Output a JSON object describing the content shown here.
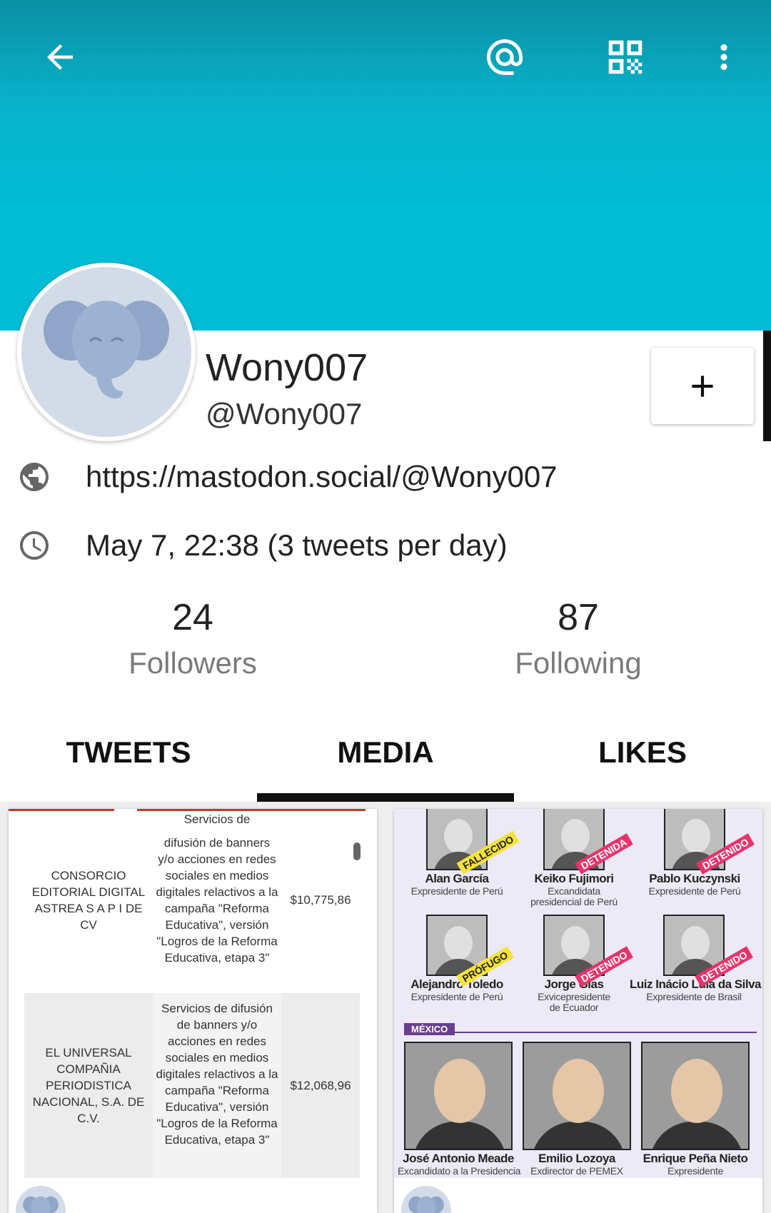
{
  "profile": {
    "display_name": "Wony007",
    "handle": "@Wony007",
    "url": "https://mastodon.social/@Wony007",
    "joined_text": "May 7, 22:38 (3 tweets per day)"
  },
  "stats": {
    "followers_count": "24",
    "followers_label": "Followers",
    "following_count": "87",
    "following_label": "Following"
  },
  "tabs": [
    {
      "label": "TWEETS",
      "active": false
    },
    {
      "label": "MEDIA",
      "active": true
    },
    {
      "label": "LIKES",
      "active": false
    }
  ],
  "colors": {
    "banner": "#00bcd4",
    "avatar_bg": "#d2dbe8",
    "avatar_icon": "#8fa6c8"
  },
  "icons": [
    "back-arrow-icon",
    "at-icon",
    "qr-code-icon",
    "more-vert-icon",
    "plus-icon",
    "globe-icon",
    "clock-icon",
    "elephant-icon"
  ],
  "media_left": {
    "top_partial": "Servicios de",
    "row1": {
      "company": "CONSORCIO EDITORIAL DIGITAL ASTREA S A P I DE CV",
      "service": "difusión de banners y/o acciones en redes sociales en medios digitales relactivos a la campaña \"Reforma Educativa\", versión \"Logros de la Reforma Educativa, etapa 3\"",
      "amount": "$10,775,86"
    },
    "row2": {
      "company": "EL UNIVERSAL COMPAÑIA PERIODISTICA NACIONAL, S.A. DE C.V.",
      "service": "Servicios de difusión de banners y/o acciones en redes sociales en medios digitales relactivos a la campaña \"Reforma Educativa\", versión \"Logros de la Reforma Educativa, etapa 3\"",
      "amount": "$12,068,96"
    }
  },
  "media_right": {
    "people": [
      {
        "name": "Alan García",
        "role": "Expresidente de Perú",
        "stamp": "FALLECIDO"
      },
      {
        "name": "Keiko Fujimori",
        "role": "Excandidata presidencial de Perú",
        "stamp": "DETENIDA"
      },
      {
        "name": "Pablo Kuczynski",
        "role": "Expresidente de Perú",
        "stamp": "DETENIDO"
      },
      {
        "name": "Alejandro Toledo",
        "role": "Expresidente de Perú",
        "stamp": "PRÓFUGO"
      },
      {
        "name": "Jorge Glas",
        "role": "Exvicepresidente de Ecuador",
        "stamp": "DETENIDO"
      },
      {
        "name": "Luiz Inácio Lula da Silva",
        "role": "Expresidente de Brasil",
        "stamp": "DETENIDO"
      }
    ],
    "section_label": "MÉXICO",
    "mexico": [
      {
        "name": "José Antonio Meade",
        "role": "Excandidato a la Presidencia"
      },
      {
        "name": "Emilio Lozoya",
        "role": "Exdirector de PEMEX"
      },
      {
        "name": "Enrique Peña Nieto",
        "role": "Expresidente"
      }
    ]
  }
}
